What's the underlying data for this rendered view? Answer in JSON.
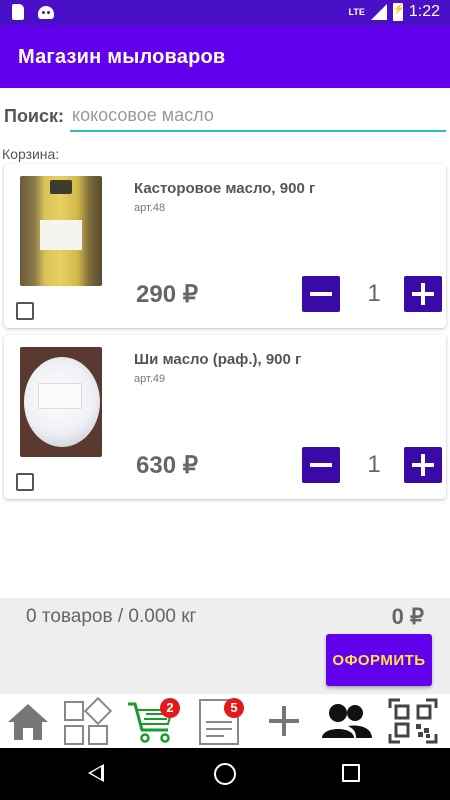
{
  "status_bar": {
    "network": "LTE",
    "time": "1:22"
  },
  "app_bar": {
    "title": "Магазин мыловаров"
  },
  "search": {
    "label": "Поиск:",
    "placeholder": "кокосовое масло",
    "value": ""
  },
  "cart": {
    "label": "Корзина:",
    "items": [
      {
        "name": "Касторовое масло, 900 г",
        "sku": "арт.48",
        "price": "290 ₽",
        "quantity": "1",
        "checked": false,
        "image": "castor-oil-bottle"
      },
      {
        "name": "Ши масло (раф.), 900 г",
        "sku": "арт.49",
        "price": "630 ₽",
        "quantity": "1",
        "checked": false,
        "image": "shea-butter-jar"
      }
    ]
  },
  "summary": {
    "totals": "0 товаров / 0.000 кг",
    "sum": "0 ₽",
    "checkout_label": "ОФОРМИТЬ"
  },
  "toolbar": {
    "items": [
      {
        "icon": "home-icon"
      },
      {
        "icon": "catalog-icon"
      },
      {
        "icon": "cart-icon",
        "badge": "2"
      },
      {
        "icon": "orders-icon",
        "badge": "5"
      },
      {
        "icon": "add-icon"
      },
      {
        "icon": "users-icon"
      },
      {
        "icon": "qr-code-icon"
      }
    ]
  },
  "colors": {
    "primary": "#6200ee",
    "status_bar": "#4a10c8",
    "button": "#3a0aa8",
    "accent_text": "#ffe14d",
    "badge": "#e41a1a",
    "cart_icon": "#1a9a2a"
  }
}
